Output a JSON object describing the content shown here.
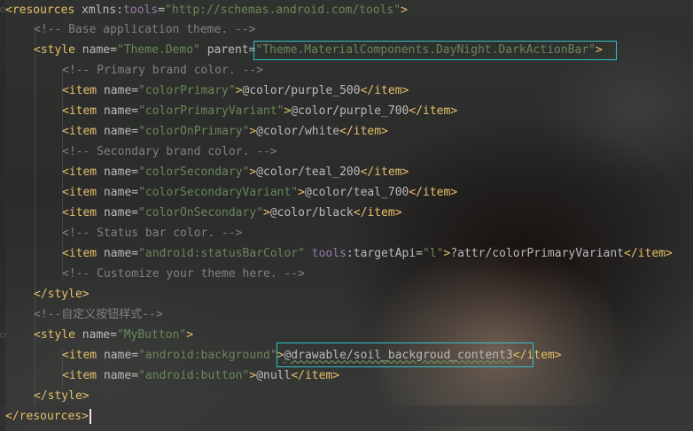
{
  "code": {
    "l1": {
      "open": "<",
      "tag": "resources",
      "sp": " ",
      "a1": "xmlns",
      "colon": ":",
      "ns": "tools",
      "eq": "=",
      "val": "\"http://schemas.android.com/tools\"",
      "close": ">"
    },
    "l2": {
      "comment": "<!-- Base application theme. -->"
    },
    "l3": {
      "open": "<",
      "tag": "style",
      "a1": "name",
      "v1": "\"Theme.Demo\"",
      "a2": "parent",
      "v2": "\"Theme.MaterialComponents.DayNight.DarkActionBar\"",
      "close": ">"
    },
    "l4": {
      "comment": "<!-- Primary brand color. -->"
    },
    "l5": {
      "name": "\"colorPrimary\"",
      "value": "@color/purple_500"
    },
    "l6": {
      "name": "\"colorPrimaryVariant\"",
      "value": "@color/purple_700"
    },
    "l7": {
      "name": "\"colorOnPrimary\"",
      "value": "@color/white"
    },
    "l8": {
      "comment": "<!-- Secondary brand color. -->"
    },
    "l9": {
      "name": "\"colorSecondary\"",
      "value": "@color/teal_200"
    },
    "l10": {
      "name": "\"colorSecondaryVariant\"",
      "value": "@color/teal_700"
    },
    "l11": {
      "name": "\"colorOnSecondary\"",
      "value": "@color/black"
    },
    "l12": {
      "comment": "<!-- Status bar color. -->"
    },
    "l13": {
      "name": "\"android:statusBarColor\"",
      "ns": "tools",
      "attr": "targetApi",
      "attrval": "\"l\"",
      "value": "?attr/colorPrimaryVariant"
    },
    "l14": {
      "comment": "<!-- Customize your theme here. -->"
    },
    "l15": {
      "text": "</style>"
    },
    "l16": {
      "comment": "<!--自定义按钮样式-->"
    },
    "l17": {
      "open": "<",
      "tag": "style",
      "a1": "name",
      "v1": "\"MyButton\"",
      "close": ">"
    },
    "l18": {
      "name": "\"android:background\"",
      "value": "@drawable/soil_backgroud_content3"
    },
    "l19": {
      "name": "\"android:button\"",
      "value": "@null"
    },
    "l20": {
      "text": "</style>"
    },
    "l21": {
      "text": "</resources>"
    }
  },
  "syntax": {
    "item_open": "<item",
    "name_attr": " name=",
    "gt": ">",
    "item_close": "</item>"
  },
  "colors": {
    "tag": "#e8bf6a",
    "value": "#6a8759",
    "comment": "#808080",
    "namespace": "#9876aa",
    "highlight_box": "#2fc3c9"
  }
}
